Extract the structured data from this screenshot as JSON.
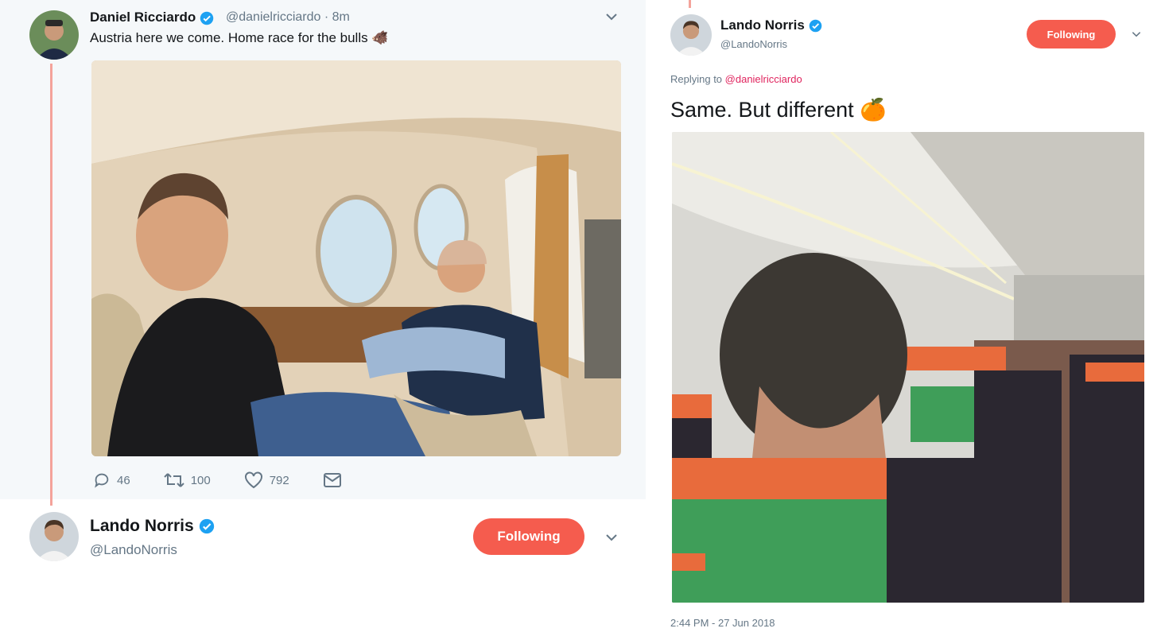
{
  "left_tweet": {
    "author_name": "Daniel Ricciardo",
    "handle_time": "@danielricciardo · 8m",
    "text": "Austria here we come. Home race for the bulls 🐗",
    "photo_description": "",
    "stats": {
      "replies": "46",
      "retweets": "100",
      "likes": "792"
    }
  },
  "left_reply": {
    "author_name": "Lando Norris",
    "handle": "@LandoNorris",
    "follow_label": "Following"
  },
  "right_tweet": {
    "author_name": "Lando Norris",
    "handle": "@LandoNorris",
    "follow_label": "Following",
    "replying_prefix": "Replying to ",
    "replying_to": "@danielricciardo",
    "text": "Same. But different 🍊",
    "timestamp": "2:44 PM - 27 Jun 2018"
  },
  "colors": {
    "accent": "#f55c4e",
    "verified": "#1da1f2",
    "thread_line": "#f4a39b",
    "muted": "#657786"
  },
  "icons": [
    "verified-badge-icon",
    "chevron-down-icon",
    "reply-icon",
    "retweet-icon",
    "like-icon",
    "message-icon"
  ]
}
